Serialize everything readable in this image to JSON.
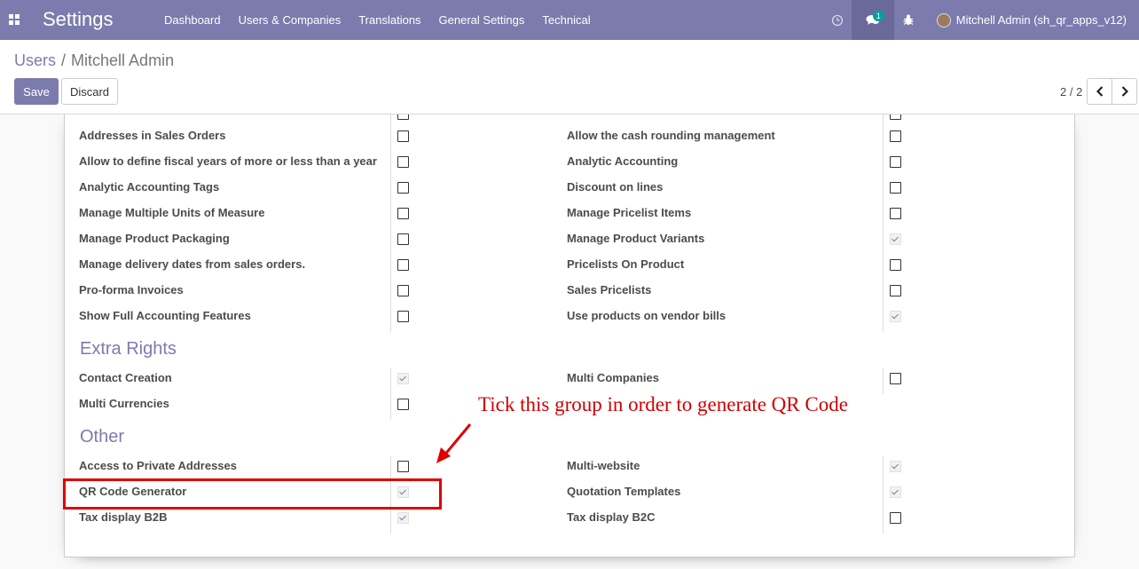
{
  "navbar": {
    "app_title": "Settings",
    "menu": [
      "Dashboard",
      "Users & Companies",
      "Translations",
      "General Settings",
      "Technical"
    ],
    "chat_badge": "1",
    "user_name": "Mitchell Admin (sh_qr_apps_v12)",
    "color": "#7c7bad"
  },
  "control_panel": {
    "breadcrumb_parent": "Users",
    "breadcrumb_current": "Mitchell Admin",
    "save_label": "Save",
    "discard_label": "Discard",
    "pager": "2 / 2"
  },
  "sections": {
    "top_rows": [
      {
        "left": "Addresses in Sales Orders",
        "left_checked": false,
        "right": "Allow the cash rounding management",
        "right_checked": false
      },
      {
        "left": "Allow to define fiscal years of more or less than a year",
        "left_checked": false,
        "right": "Analytic Accounting",
        "right_checked": false
      },
      {
        "left": "Analytic Accounting Tags",
        "left_checked": false,
        "right": "Discount on lines",
        "right_checked": false
      },
      {
        "left": "Manage Multiple Units of Measure",
        "left_checked": false,
        "right": "Manage Pricelist Items",
        "right_checked": false
      },
      {
        "left": "Manage Product Packaging",
        "left_checked": false,
        "right": "Manage Product Variants",
        "right_checked": true
      },
      {
        "left": "Manage delivery dates from sales orders.",
        "left_checked": false,
        "right": "Pricelists On Product",
        "right_checked": false
      },
      {
        "left": "Pro-forma Invoices",
        "left_checked": false,
        "right": "Sales Pricelists",
        "right_checked": false
      },
      {
        "left": "Show Full Accounting Features",
        "left_checked": false,
        "right": "Use products on vendor bills",
        "right_checked": true
      }
    ],
    "extra_rights": {
      "title": "Extra Rights",
      "rows": [
        {
          "left": "Contact Creation",
          "left_checked": true,
          "right": "Multi Companies",
          "right_checked": false
        },
        {
          "left": "Multi Currencies",
          "left_checked": false,
          "right": "",
          "right_checked": null
        }
      ]
    },
    "other": {
      "title": "Other",
      "rows": [
        {
          "left": "Access to Private Addresses",
          "left_checked": false,
          "right": "Multi-website",
          "right_checked": true
        },
        {
          "left": "QR Code Generator",
          "left_checked": true,
          "right": "Quotation Templates",
          "right_checked": true
        },
        {
          "left": "Tax display B2B",
          "left_checked": true,
          "right": "Tax display B2C",
          "right_checked": false
        }
      ]
    }
  },
  "annotation": {
    "text": "Tick this group in order to generate QR Code",
    "color": "#d00000"
  }
}
